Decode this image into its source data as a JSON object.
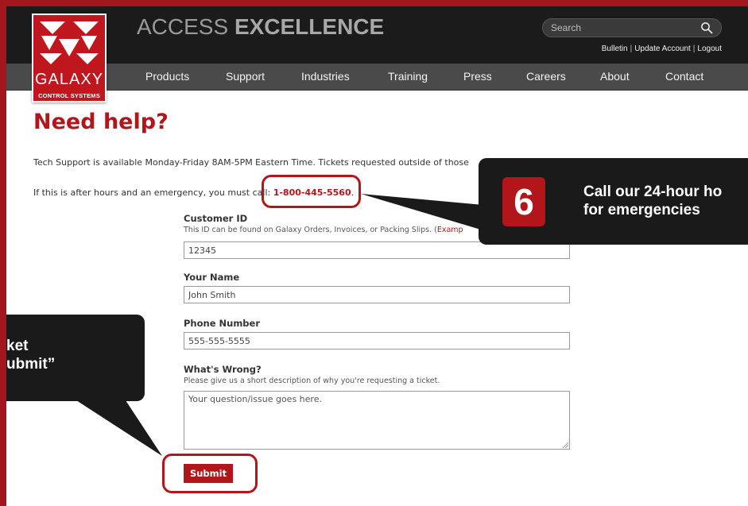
{
  "header": {
    "brand_light": "ACCESS",
    "brand_bold": "EXCELLENCE",
    "search_placeholder": "Search",
    "user_links": [
      "Bulletin",
      "Update Account",
      "Logout"
    ],
    "nav": [
      "Products",
      "Support",
      "Industries",
      "Training",
      "Press",
      "Careers",
      "About",
      "Contact"
    ]
  },
  "logo": {
    "line1": "GALAXY",
    "line2": "CONTROL SYSTEMS"
  },
  "main": {
    "title": "Need help?",
    "para1": "Tech Support is available Monday-Friday 8AM-5PM Eastern Time. Tickets requested outside of those",
    "para2_prefix": "If this is after hours and an emergency, you must call: ",
    "phone": "1-800-445-5560",
    "para2_suffix": "."
  },
  "form": {
    "customer_id": {
      "label": "Customer ID",
      "help": "This ID can be found on Galaxy Orders, Invoices, or Packing Slips. (",
      "help_link": "Examp",
      "value": "12345"
    },
    "name": {
      "label": "Your Name",
      "value": "John Smith"
    },
    "phone": {
      "label": "Phone Number",
      "value": "555-555-5555"
    },
    "issue": {
      "label": "What's Wrong?",
      "help": "Please give us a short description of why you're requesting a ticket.",
      "placeholder": "Your question/issue goes here."
    },
    "submit_label": "Submit"
  },
  "callouts": {
    "right": {
      "number": "6",
      "line1": "Call our 24-hour ho",
      "line2": "for emergencies"
    },
    "left": {
      "line1": "ket",
      "line2": "ubmit”"
    }
  },
  "colors": {
    "brand_red": "#b2151a",
    "dark": "#1b1b1b",
    "nav": "#4a4a4a"
  }
}
